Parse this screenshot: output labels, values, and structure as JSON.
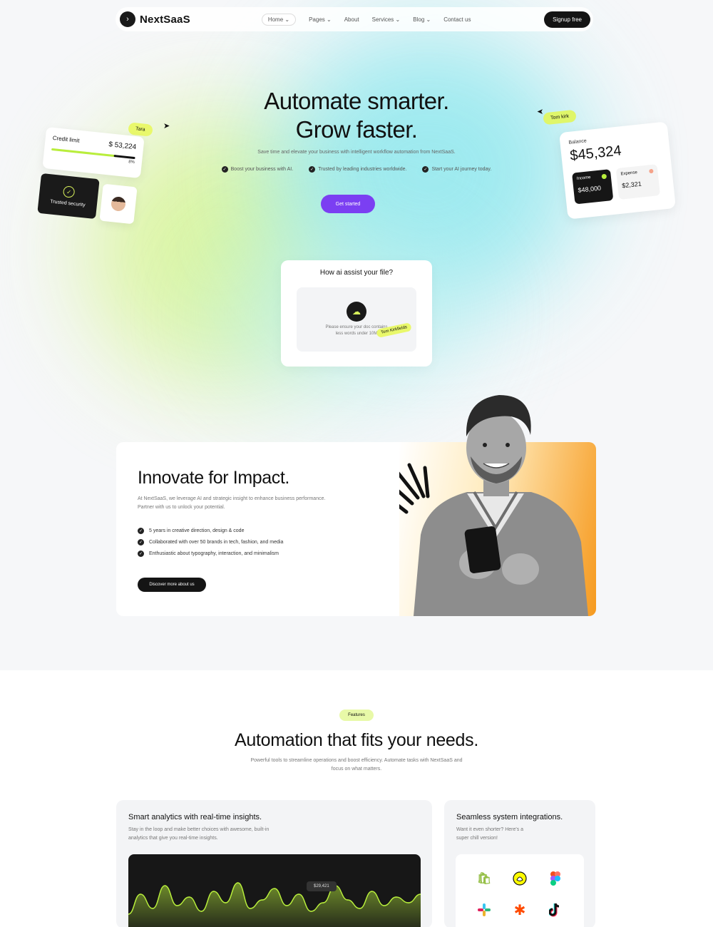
{
  "nav": {
    "logo": "NextSaaS",
    "links": [
      "Home",
      "Pages",
      "About",
      "Services",
      "Blog",
      "Contact us"
    ],
    "cta": "Signup free"
  },
  "hero": {
    "title_line1": "Automate smarter.",
    "title_line2": "Grow faster.",
    "subtitle": "Save time and elevate your business with intelligent workflow automation from NextSaaS.",
    "checks": [
      "Boost your business with AI.",
      "Trusted by leading industries worldwide.",
      "Start your AI journey today."
    ],
    "cta": "Get started"
  },
  "left_cards": {
    "tag": "Tara",
    "credit_label": "Credit limit",
    "credit_amount": "$ 53,224",
    "credit_pct": "8%",
    "credit_fill": 0.78,
    "badge_text": "Trusted security"
  },
  "right_cards": {
    "tag": "Tom kirk",
    "balance_label": "Balance",
    "balance_value": "$45,324",
    "income_label": "Income",
    "income_value": "$48,000",
    "expense_label": "Expense",
    "expense_value": "$2,321"
  },
  "upload": {
    "title": "How ai assist your file?",
    "text_line1": "Please ensure your doc contains",
    "text_line2": "less words under 10M",
    "tag": "Tom Kirkfields"
  },
  "impact": {
    "title": "Innovate for Impact.",
    "desc": "At NextSaaS, we leverage AI and strategic insight to enhance business performance. Partner with us to unlock your potential.",
    "items": [
      "5 years in creative direction, design & code",
      "Collaborated with over 50 brands in tech, fashion, and media",
      "Enthusiastic about typography, interaction, and minimalism"
    ],
    "cta": "Discover more about us"
  },
  "features": {
    "badge": "Features",
    "title": "Automation that fits your needs.",
    "subtitle": "Powerful tools to streamline operations and boost efficiency. Automate tasks with NextSaaS and focus on what matters.",
    "panel_a": {
      "title": "Smart analytics with real-time insights.",
      "desc_line1": "Stay in the loop and make better choices with awesome, built-in",
      "desc_line2": "analytics that give you real-time insights.",
      "tooltip": "$29,421"
    },
    "panel_b": {
      "title": "Seamless system integrations.",
      "desc_line1": "Want it even shorter? Here's a",
      "desc_line2": "super chill version!",
      "apps": [
        "shopify-icon",
        "snapchat-icon",
        "figma-icon",
        "slack-icon",
        "zapier-icon",
        "tiktok-icon"
      ]
    }
  },
  "colors": {
    "accent_purple": "#7b3ff2",
    "lime": "#e9f86b",
    "dark": "#141414",
    "chart_line": "#b8ee3c"
  },
  "chart_data": {
    "type": "area",
    "title": "",
    "x": [
      0,
      1,
      2,
      3,
      4,
      5,
      6,
      7,
      8,
      9,
      10,
      11,
      12,
      13,
      14,
      15,
      16,
      17,
      18,
      19,
      20,
      21,
      22,
      23,
      24
    ],
    "series": [
      {
        "values": [
          20,
          55,
          30,
          70,
          35,
          50,
          25,
          60,
          40,
          75,
          30,
          45,
          65,
          35,
          55,
          25,
          40,
          70,
          45,
          30,
          60,
          35,
          50,
          40,
          55
        ]
      }
    ],
    "ylim": [
      0,
      100
    ],
    "grid": false
  }
}
